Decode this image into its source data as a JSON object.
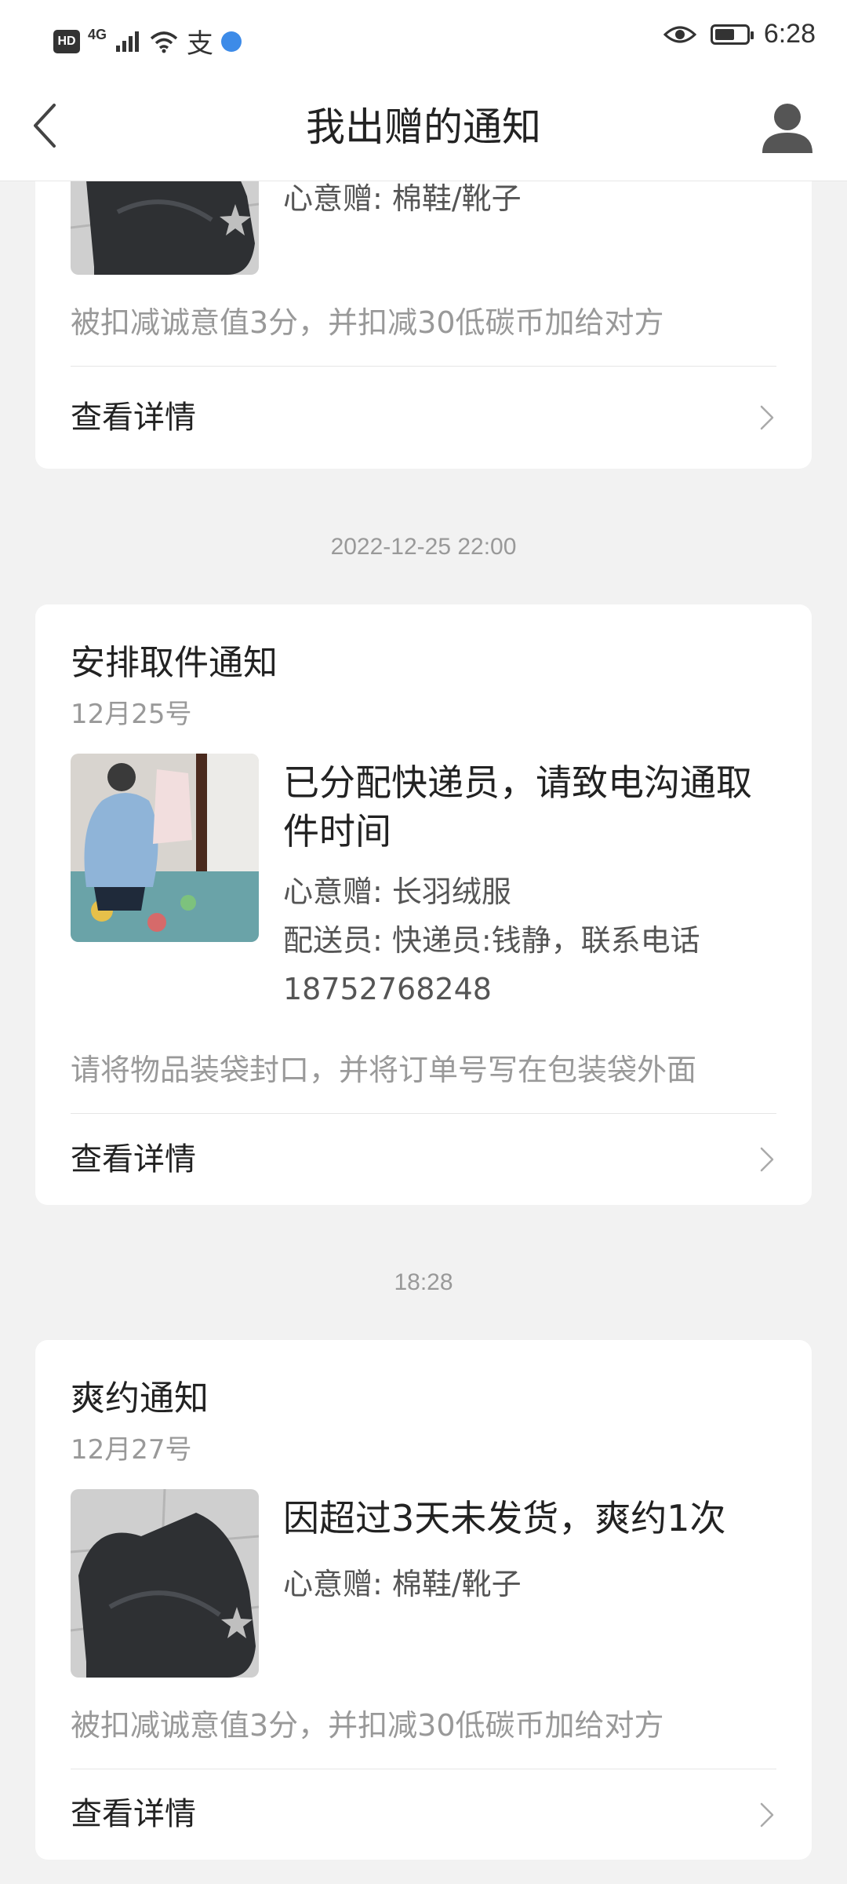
{
  "status_bar": {
    "hd": "HD",
    "network": "4G",
    "alipay": "支",
    "time": "6:28"
  },
  "header": {
    "title": "我出赠的通知"
  },
  "cards": [
    {
      "gift": "心意赠: 棉鞋/靴子",
      "note": "被扣减诚意值3分，并扣减30低碳币加给对方",
      "detail_label": "查看详情"
    },
    {
      "timestamp": "2022-12-25 22:00",
      "title": "安排取件通知",
      "date": "12月25号",
      "headline": "已分配快递员，请致电沟通取件时间",
      "gift": "心意赠: 长羽绒服",
      "courier": "配送员: 快递员:钱静，联系电话18752768248",
      "note": "请将物品装袋封口，并将订单号写在包装袋外面",
      "detail_label": "查看详情"
    },
    {
      "timestamp": "18:28",
      "title": "爽约通知",
      "date": "12月27号",
      "headline": "因超过3天未发货，爽约1次",
      "gift": "心意赠: 棉鞋/靴子",
      "note": "被扣减诚意值3分，并扣减30低碳币加给对方",
      "detail_label": "查看详情"
    }
  ],
  "icons": {
    "back": "back-arrow-icon",
    "profile": "user-avatar-icon",
    "chevron": "chevron-right-icon"
  }
}
